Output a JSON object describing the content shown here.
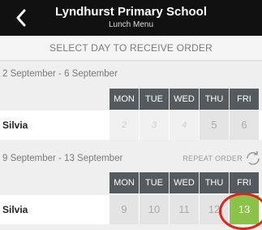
{
  "header": {
    "title": "Lyndhurst Primary School",
    "subtitle": "Lunch Menu",
    "back_icon": "chevron-left-icon"
  },
  "instruction": "SELECT DAY TO RECEIVE ORDER",
  "weeks": [
    {
      "label": "2 September - 6 September",
      "days": [
        "MON",
        "TUE",
        "WED",
        "THU",
        "FRI"
      ],
      "rows": [
        {
          "name": "Silvia",
          "dates": [
            "2",
            "3",
            "4",
            "5",
            "6"
          ]
        }
      ]
    },
    {
      "label": "9 September - 13 September",
      "repeat_label": "REPEAT ORDER",
      "days": [
        "MON",
        "TUE",
        "WED",
        "THU",
        "FRI"
      ],
      "rows": [
        {
          "name": "Silvia",
          "dates": [
            "9",
            "10",
            "11",
            "12",
            "13"
          ]
        }
      ]
    }
  ],
  "colors": {
    "header_bg": "#111111",
    "day_header_bg": "#555a5f",
    "selected_day": "#8bc34a",
    "highlight_circle": "#e0221a"
  }
}
